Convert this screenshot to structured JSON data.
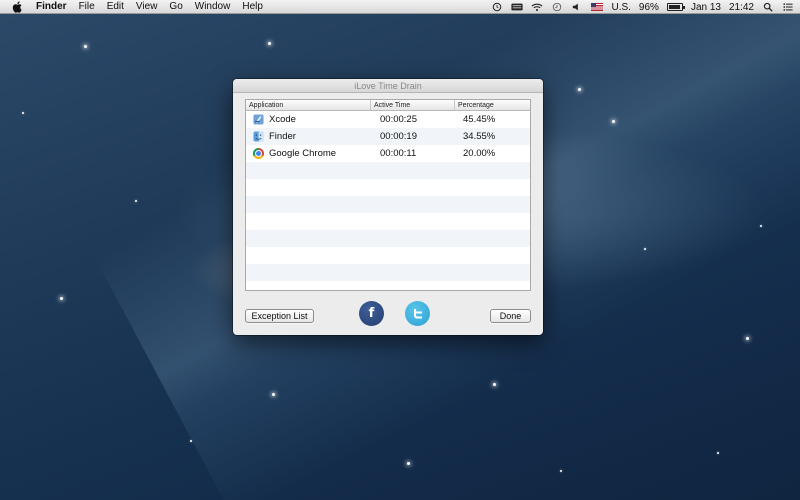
{
  "menubar": {
    "app_name": "Finder",
    "items": [
      "File",
      "Edit",
      "View",
      "Go",
      "Window",
      "Help"
    ],
    "input_source": "U.S.",
    "battery": "96%",
    "date": "Jan 13",
    "time": "21:42",
    "icons": [
      "apple-icon",
      "time-machine-icon",
      "keyboard-icon",
      "wifi-icon",
      "clock-icon",
      "volume-icon",
      "flag-us-icon",
      "battery-icon",
      "spotlight-icon",
      "notification-center-icon"
    ]
  },
  "window": {
    "title": "iLove Time Drain",
    "table": {
      "columns": [
        "Application",
        "Active Time",
        "Percentage"
      ],
      "rows": [
        {
          "app": "Xcode",
          "time": "00:00:25",
          "percent": "45.45%",
          "icon": "xcode-icon"
        },
        {
          "app": "Finder",
          "time": "00:00:19",
          "percent": "34.55%",
          "icon": "finder-icon"
        },
        {
          "app": "Google Chrome",
          "time": "00:00:11",
          "percent": "20.00%",
          "icon": "chrome-icon"
        }
      ]
    },
    "buttons": {
      "exception_list": "Exception List",
      "done": "Done",
      "facebook_letter": "f"
    },
    "colors": {
      "facebook": "#2b4777",
      "twitter": "#3bafdd",
      "row_alt": "#f1f5fa"
    }
  }
}
